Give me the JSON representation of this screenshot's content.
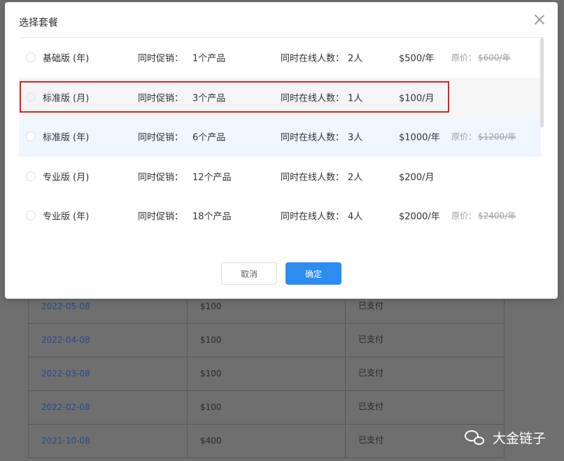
{
  "dialog": {
    "title": "选择套餐",
    "cancel_label": "取消",
    "confirm_label": "确定"
  },
  "labels": {
    "promo": "同时促销：",
    "online": "同时在线人数："
  },
  "plans": [
    {
      "name": "基础版 (年)",
      "products": "1个产品",
      "online": "2人",
      "price": "$500/年",
      "original_label": "原价：",
      "original_price": "$600/年",
      "selected": false
    },
    {
      "name": "标准版 (月)",
      "products": "3个产品",
      "online": "1人",
      "price": "$100/月",
      "original_label": "",
      "original_price": "",
      "selected": false
    },
    {
      "name": "标准版 (年)",
      "products": "6个产品",
      "online": "3人",
      "price": "$1000/年",
      "original_label": "原价：",
      "original_price": "$1200/年",
      "selected": false
    },
    {
      "name": "专业版 (月)",
      "products": "12个产品",
      "online": "2人",
      "price": "$200/月",
      "original_label": "",
      "original_price": "",
      "selected": false
    },
    {
      "name": "专业版 (年)",
      "products": "18个产品",
      "online": "4人",
      "price": "$2000/年",
      "original_label": "原价：",
      "original_price": "$2400/年",
      "selected": false
    }
  ],
  "background_table": {
    "rows": [
      {
        "date": "2022-05-08",
        "amount": "$100",
        "status": "已支付"
      },
      {
        "date": "2022-04-08",
        "amount": "$100",
        "status": "已支付"
      },
      {
        "date": "2022-03-08",
        "amount": "$100",
        "status": "已支付"
      },
      {
        "date": "2022-02-08",
        "amount": "$100",
        "status": "已支付"
      },
      {
        "date": "2021-10-08",
        "amount": "$400",
        "status": "已支付"
      }
    ]
  },
  "watermark": {
    "text": "大金链子",
    "icon": "wechat-icon"
  },
  "colors": {
    "primary": "#2d8cf0",
    "highlight_border": "#e02020"
  }
}
